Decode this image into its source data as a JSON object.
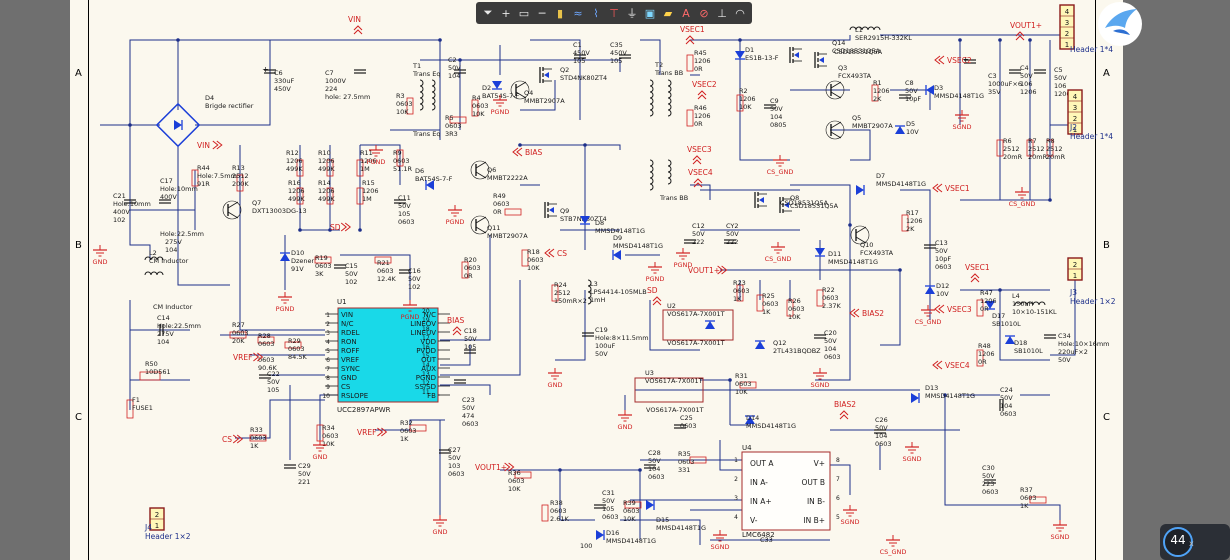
{
  "toolbar": {
    "tools": [
      "filter-icon",
      "plus-icon",
      "rect-select-icon",
      "line-icon",
      "bus-icon",
      "wire-icon",
      "net-icon",
      "power-icon",
      "gnd-icon",
      "component-icon",
      "label-icon",
      "text-icon",
      "error-icon",
      "dimension-icon",
      "arc-icon"
    ]
  },
  "zoom": {
    "value": "44",
    "unit": "x"
  },
  "zones": {
    "rows": [
      "A",
      "B",
      "C"
    ],
    "cols": []
  },
  "nets": {
    "vin": "VIN",
    "bias": "BIAS",
    "vsec1": "VSEC1",
    "vsec2": "VSEC2",
    "vsec3": "VSEC3",
    "vsec4": "VSEC4",
    "vout1": "VOUT1+",
    "sd": "SD",
    "cs": "CS",
    "vref": "VREF",
    "bias2": "BIAS2",
    "gnd": "GND",
    "pgnd": "PGND",
    "sgnd": "SGND",
    "cs_gnd": "CS_GND"
  },
  "components": {
    "j1": [
      "J1",
      "Header 1×2"
    ],
    "j2": [
      "J2",
      "Header 1*4"
    ],
    "j3": [
      "J3",
      "Header 1×2"
    ],
    "j4": [
      "J4",
      "Header 1×2"
    ],
    "hdr_top": [
      "Header 1*4"
    ],
    "d4": [
      "D4",
      "Brigde rectifier"
    ],
    "c6": [
      "C6",
      "330uF",
      "450V"
    ],
    "c7": [
      "C7",
      "1000V",
      "224",
      "hole: 27.5mm"
    ],
    "t1": [
      "T1",
      "Trans Eq"
    ],
    "t2": [
      "T2",
      "Trans BB"
    ],
    "c21": [
      "C21",
      "Hole:10mm",
      "400V",
      "102"
    ],
    "c17": [
      "C17",
      "Hole:10mm",
      "400V"
    ],
    "c10b": [
      "Hole:22.5mm",
      "275V",
      "104"
    ],
    "l2": [
      "L2",
      "CM Inductor"
    ],
    "c14": [
      "C14",
      "Hole:22.5mm",
      "275V",
      "104"
    ],
    "r50": [
      "R50",
      "10D561"
    ],
    "f1": [
      "F1",
      "FUSE1"
    ],
    "r44": [
      "R44",
      "Hole:7.5mm",
      "91R"
    ],
    "r13": [
      "R13",
      "2512",
      "200K"
    ],
    "q7": [
      "Q7",
      "DXT13003DG-13"
    ],
    "r12": [
      "R12",
      "1206",
      "499K"
    ],
    "r16": [
      "R16",
      "1206",
      "499K"
    ],
    "r10": [
      "R10",
      "1206",
      "499K"
    ],
    "r14": [
      "R14",
      "1206",
      "499K"
    ],
    "r11": [
      "R11",
      "1206",
      "1M"
    ],
    "r15": [
      "R15",
      "1206",
      "1M"
    ],
    "r9": [
      "R9",
      "0603",
      "51.1R"
    ],
    "c11": [
      "C11",
      "50V",
      "105",
      "0603"
    ],
    "d10": [
      "D10",
      "Dzener",
      "91V"
    ],
    "r19": [
      "R19",
      "0603",
      "3K"
    ],
    "c15": [
      "C15",
      "50V",
      "102"
    ],
    "r21": [
      "R21",
      "0603",
      "12.4K"
    ],
    "c16": [
      "C16",
      "50V",
      "102"
    ],
    "u1": {
      "name": "U1",
      "part": "UCC2897APWR",
      "left": [
        "VIN",
        "N/C",
        "RDEL",
        "RON",
        "ROFF",
        "VREF",
        "SYNC",
        "GND",
        "CS",
        "RSLOPE"
      ],
      "right": [
        "N/C",
        "LINEOV",
        "LINEUV",
        "VDD",
        "PVDD",
        "OUT",
        "AUX",
        "PGND",
        "SS/SD",
        "FB"
      ],
      "lnum": [
        "1",
        "2",
        "3",
        "4",
        "5",
        "6",
        "7",
        "8",
        "9",
        "10"
      ],
      "rnum": [
        "20",
        "19",
        "18",
        "17",
        "16",
        "15",
        "14",
        "13",
        "12",
        "11"
      ]
    },
    "r27": [
      "R27",
      "0603",
      "20K"
    ],
    "r28": [
      "R28",
      "0603"
    ],
    "r29": [
      "R29",
      "0603",
      "84.5K"
    ],
    "r1b": [
      "0603",
      "90.6K"
    ],
    "c22": [
      "C22",
      "50V",
      "105"
    ],
    "r33": [
      "R33",
      "0603",
      "1K"
    ],
    "c29": [
      "C29",
      "50V",
      "221"
    ],
    "r34": [
      "R34",
      "0603",
      "10K"
    ],
    "c23": [
      "C23",
      "50V",
      "474",
      "0603"
    ],
    "c18": [
      "C18",
      "50V",
      "105"
    ],
    "r32": [
      "R32",
      "0603",
      "1K"
    ],
    "c27": [
      "C27",
      "50V",
      "103",
      "0603"
    ],
    "r3": [
      "R3",
      "0603",
      "10K"
    ],
    "c2": [
      "C2",
      "50V",
      "104"
    ],
    "r5": [
      "R5",
      "0603",
      "3R3"
    ],
    "r4": [
      "R4",
      "0603",
      "10K"
    ],
    "d2": [
      "D2",
      "BAT54S-7-F"
    ],
    "q4": [
      "Q4",
      "MMBT2907A"
    ],
    "q2": [
      "Q2",
      "STD4NK80ZT4"
    ],
    "c1": [
      "C1",
      "450V",
      "105"
    ],
    "c35": [
      "C35",
      "450V",
      "105"
    ],
    "d6": [
      "D6",
      "BAT54S-7-F"
    ],
    "q6": [
      "Q6",
      "MMBT2222A"
    ],
    "r49": [
      "R49",
      "0603",
      "0R"
    ],
    "q11": [
      "Q11",
      "MMBT2907A"
    ],
    "r20": [
      "R20",
      "0603",
      "0R"
    ],
    "q9": [
      "Q9",
      "STB7NK80ZT4"
    ],
    "d8": [
      "D8",
      "MMSD4148T1G"
    ],
    "d9": [
      "D9",
      "MMSD4148T1G"
    ],
    "r18": [
      "R18",
      "0603",
      "10K"
    ],
    "r24": [
      "R24",
      "2512",
      "150mR×2"
    ],
    "l3": [
      "L3",
      "LPS4414-105MLB",
      "1mH"
    ],
    "c19": [
      "C19",
      "Hole:8×11.5mm",
      "100uF",
      "50V"
    ],
    "r45": [
      "R45",
      "1206",
      "0R"
    ],
    "r46": [
      "R46",
      "1206",
      "0R"
    ],
    "d1": [
      "D1",
      "ES1B-13-F"
    ],
    "r2": [
      "R2",
      "1206",
      "10K"
    ],
    "c9": [
      "C9",
      "50V",
      "104",
      "0805"
    ],
    "q14": [
      "Q14",
      "CSD18531Q5A"
    ],
    "q13": [
      "CSD18531Q5A"
    ],
    "l1": [
      "L1",
      "SER2915H-332KL"
    ],
    "q3": [
      "Q3",
      "FCX493TA"
    ],
    "r1": [
      "R1",
      "1206",
      "2K"
    ],
    "c8": [
      "C8",
      "50V",
      "10pF"
    ],
    "d3": [
      "D3",
      "MMSD4148T1G"
    ],
    "q5": [
      "Q5",
      "MMBT2907A"
    ],
    "d5": [
      "D5",
      "10V"
    ],
    "c3": [
      "C3",
      "1000uF×6",
      "35V"
    ],
    "c4": [
      "C4",
      "50V",
      "106",
      "1206"
    ],
    "c5": [
      "C5",
      "50V",
      "106",
      "1206"
    ],
    "r6": [
      "R6",
      "2512",
      "20mR"
    ],
    "r7": [
      "R7",
      "2512",
      "20mR"
    ],
    "r8": [
      "R8",
      "2512",
      "20mR"
    ],
    "q8": [
      "Q8",
      "CSD18531Q5A"
    ],
    "q12b": [
      "CSD18531Q5A"
    ],
    "d7": [
      "D7",
      "MMSD4148T1G"
    ],
    "r17": [
      "R17",
      "1206",
      "2K"
    ],
    "q10": [
      "Q10",
      "FCX493TA"
    ],
    "c13": [
      "C13",
      "50V",
      "10pF",
      "0603"
    ],
    "d11": [
      "D11",
      "MMSD4148T1G"
    ],
    "d12": [
      "D12",
      "10V"
    ],
    "c12": [
      "C12",
      "50V",
      "222"
    ],
    "cy2": [
      "CY2",
      "50V",
      "222"
    ],
    "r23": [
      "R23",
      "0603",
      "1K"
    ],
    "r25": [
      "R25",
      "0603",
      "1K"
    ],
    "r26": [
      "R26",
      "0603",
      "10K"
    ],
    "r22": [
      "R22",
      "0603",
      "2.37K"
    ],
    "u2": [
      "U2",
      "VOS617A-7X001T"
    ],
    "q12": [
      "Q12",
      "2TL431BQDBZ"
    ],
    "c20": [
      "C20",
      "50V",
      "104",
      "0603"
    ],
    "r47": [
      "R47",
      "1206",
      "0R"
    ],
    "d17": [
      "D17",
      "SB1010L"
    ],
    "l4": [
      "L4",
      "150uH",
      "10×10-151KL"
    ],
    "c34": [
      "C34",
      "Hole:10×16mm",
      "220uF×2",
      "50V"
    ],
    "d18": [
      "D18",
      "SB1010L"
    ],
    "r48": [
      "R48",
      "1206",
      "0R"
    ],
    "u3": [
      "U3",
      "VOS617A-7X001T"
    ],
    "r31": [
      "R31",
      "0603",
      "10K"
    ],
    "d14": [
      "D14",
      "MMSD4148T1G"
    ],
    "c25": [
      "C25",
      "0603"
    ],
    "d13": [
      "D13",
      "MMSD4148T1G"
    ],
    "c24": [
      "C24",
      "50V",
      "104",
      "0603"
    ],
    "c26": [
      "C26",
      "50V",
      "104",
      "0603"
    ],
    "u4": {
      "name": "U4",
      "part": "LMC6482",
      "left": [
        "OUT A",
        "IN A-",
        "IN A+",
        "V-"
      ],
      "right": [
        "V+",
        "OUT B",
        "IN B-",
        "IN B+"
      ],
      "lnum": [
        "1",
        "2",
        "3",
        "4"
      ],
      "rnum": [
        "8",
        "7",
        "6",
        "5"
      ]
    },
    "c28": [
      "C28",
      "50V",
      "104",
      "0603"
    ],
    "r35": [
      "R35",
      "0603",
      "331"
    ],
    "r36": [
      "R36",
      "0603",
      "10K"
    ],
    "r38": [
      "R38",
      "0603",
      "2.61K"
    ],
    "c31": [
      "C31",
      "50V",
      "105",
      "0603"
    ],
    "r39": [
      "R39",
      "0603",
      "10K"
    ],
    "d15": [
      "D15",
      "MMSD4148T1G"
    ],
    "d16": [
      "D16",
      "MMSD4148T1G"
    ],
    "c30": [
      "C30",
      "50V",
      "223",
      "0603"
    ],
    "r37": [
      "R37",
      "0603",
      "1K"
    ],
    "c33": [
      "C33"
    ],
    "r40": [
      "R40",
      "100"
    ]
  }
}
